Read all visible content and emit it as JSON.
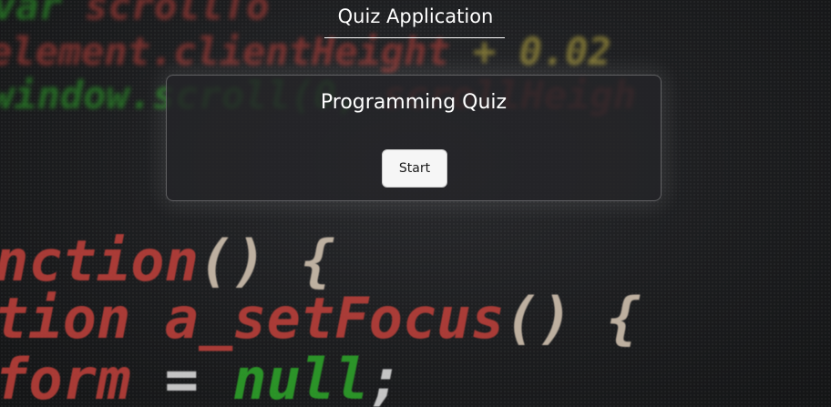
{
  "header": {
    "title": "Quiz Application"
  },
  "quiz": {
    "title": "Programming Quiz",
    "start_label": "Start"
  },
  "background": {
    "code_lines": [
      "var scrollTo",
      "element.clientHeight + 0.02",
      "window.scroll(0, scrollHeigh",
      "nction() {",
      "tion a_setFocus() {",
      "form = null;"
    ]
  },
  "colors": {
    "card_border": "#5a5b5e",
    "button_bg": "#f6f6f6",
    "code_red": "#c2413b",
    "code_green": "#2ea82a",
    "code_yellow": "#c9b643"
  }
}
